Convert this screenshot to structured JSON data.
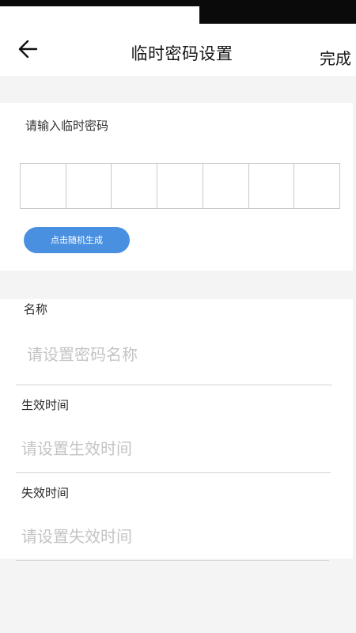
{
  "header": {
    "title": "临时密码设置",
    "done_label": "完成"
  },
  "code_section": {
    "prompt": "请输入临时密码",
    "digits": [
      "",
      "",
      "",
      "",
      "",
      "",
      ""
    ],
    "random_button_label": "点击随机生成"
  },
  "fields": {
    "name": {
      "label": "名称",
      "value": "",
      "placeholder": "请设置密码名称"
    },
    "effective_time": {
      "label": "生效时间",
      "value": "",
      "placeholder": "请设置生效时间"
    },
    "expiry_time": {
      "label": "失效时间",
      "value": "",
      "placeholder": "请设置失效时间"
    }
  },
  "icons": {
    "back": "arrow-left-icon"
  }
}
